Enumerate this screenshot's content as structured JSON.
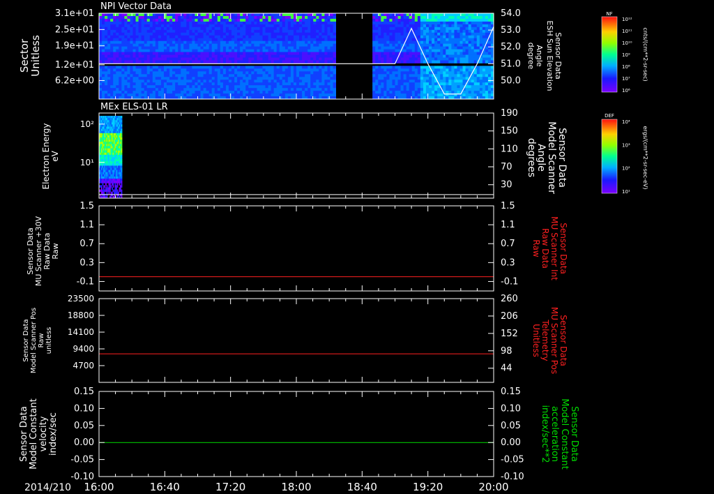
{
  "date_label": "2014/210",
  "x_axis": {
    "ticks": [
      "16:00",
      "16:40",
      "17:20",
      "18:00",
      "18:40",
      "19:20",
      "20:00"
    ],
    "range": [
      "16:00",
      "20:00"
    ]
  },
  "colors": {
    "background": "#000000",
    "axes": "#ffffff",
    "red_trace": "#ff2020",
    "green_trace": "#00dd00"
  },
  "colorbars": [
    {
      "label": "NF",
      "unit": "cnts/(cm**2-sr-sec)",
      "ticks": [
        "10¹²",
        "10¹¹",
        "10¹⁰",
        "10⁹",
        "10⁸",
        "10⁷",
        "10⁶"
      ]
    },
    {
      "label": "DEF",
      "unit": "ergs/(cm**2-sr-sec-eV)",
      "ticks": [
        "10⁴",
        "10³",
        "10²",
        "10¹"
      ]
    }
  ],
  "chart_data": [
    {
      "type": "heatmap",
      "title": "NPI Vector Data",
      "ylabel_left": [
        "Sector",
        "Unitless"
      ],
      "y_ticks_left": [
        "3.1e+01",
        "2.5e+01",
        "1.9e+01",
        "1.2e+01",
        "6.2e+00"
      ],
      "ylim_left": [
        0,
        31
      ],
      "ylabel_right": [
        "ESH Sun Elevation",
        "Sensor Data",
        "Angle",
        "degree"
      ],
      "y_ticks_right": [
        "54.0",
        "53.0",
        "52.0",
        "51.0",
        "50.0"
      ],
      "ylim_right": [
        49.0,
        54.0
      ],
      "data_gap": [
        "18:24",
        "18:46"
      ],
      "overlay_line": {
        "name": "ESH Sun Elevation",
        "x": [
          "16:00",
          "19:00",
          "19:10",
          "19:20",
          "19:30",
          "19:40",
          "19:50",
          "20:00"
        ],
        "y": [
          51.0,
          51.0,
          53.1,
          51.0,
          49.2,
          49.2,
          51.0,
          53.2
        ]
      }
    },
    {
      "type": "heatmap",
      "title": "MEx ELS-01 LR",
      "ylabel_left": [
        "Electron Energy",
        "eV"
      ],
      "y_ticks_left": [
        "10²",
        "10¹"
      ],
      "y_scale_left": "log",
      "ylabel_right": [
        "Sensor Data",
        "Model Scanner",
        "Angle",
        "degrees"
      ],
      "y_ticks_right": [
        "190",
        "150",
        "110",
        "70",
        "30"
      ],
      "ylim_right": [
        0,
        190
      ],
      "data_extent": [
        "16:00",
        "16:14"
      ],
      "overlay_line": {
        "name": "Model Scanner Angle",
        "x": [
          "16:00",
          "20:00"
        ],
        "y": [
          8,
          8
        ]
      }
    },
    {
      "type": "line",
      "ylabel_left": [
        "Sensor Data",
        "MU Scanner +30V",
        "Raw Data",
        "Raw"
      ],
      "y_ticks_left": [
        "1.5",
        "1.1",
        "0.7",
        "0.3",
        "-0.1"
      ],
      "ylim": [
        -0.3,
        1.5
      ],
      "ylabel_right": [
        "Sensor Data",
        "MU Scanner Int",
        "Raw Data",
        "Raw"
      ],
      "y_ticks_right": [
        "1.5",
        "1.1",
        "0.7",
        "0.3",
        "-0.1"
      ],
      "series": [
        {
          "x": [
            "16:00",
            "20:00"
          ],
          "values": [
            0.0,
            0.0
          ]
        }
      ]
    },
    {
      "type": "line",
      "ylabel_left": [
        "Sensor Data",
        "Model Scanner Pos",
        "Raw",
        "unitless"
      ],
      "y_ticks_left": [
        "23500",
        "18800",
        "14100",
        "9400",
        "4700"
      ],
      "ylim": [
        0,
        23500
      ],
      "ylabel_right": [
        "Sensor Data",
        "MU Scanner Pos",
        "Telemetry",
        "Unitless"
      ],
      "y_ticks_right": [
        "260",
        "206",
        "152",
        "98",
        "44"
      ],
      "ylim_right": [
        0,
        260
      ],
      "series": [
        {
          "x": [
            "16:00",
            "20:00"
          ],
          "values": [
            8000,
            8000
          ]
        }
      ]
    },
    {
      "type": "line",
      "ylabel_left": [
        "Sensor Data",
        "Model Constant",
        "velocity",
        "index/sec"
      ],
      "y_ticks_left": [
        "0.15",
        "0.10",
        "0.05",
        "0.00",
        "-0.05",
        "-0.10"
      ],
      "ylim": [
        -0.1,
        0.15
      ],
      "ylabel_right": [
        "Sensor Data",
        "Model Constant",
        "acceleration",
        "index/sec**2"
      ],
      "y_ticks_right": [
        "0.15",
        "0.10",
        "0.05",
        "0.00",
        "-0.05",
        "-0.10"
      ],
      "series": [
        {
          "x": [
            "16:00",
            "20:00"
          ],
          "values": [
            0.0,
            0.0
          ]
        }
      ]
    }
  ]
}
